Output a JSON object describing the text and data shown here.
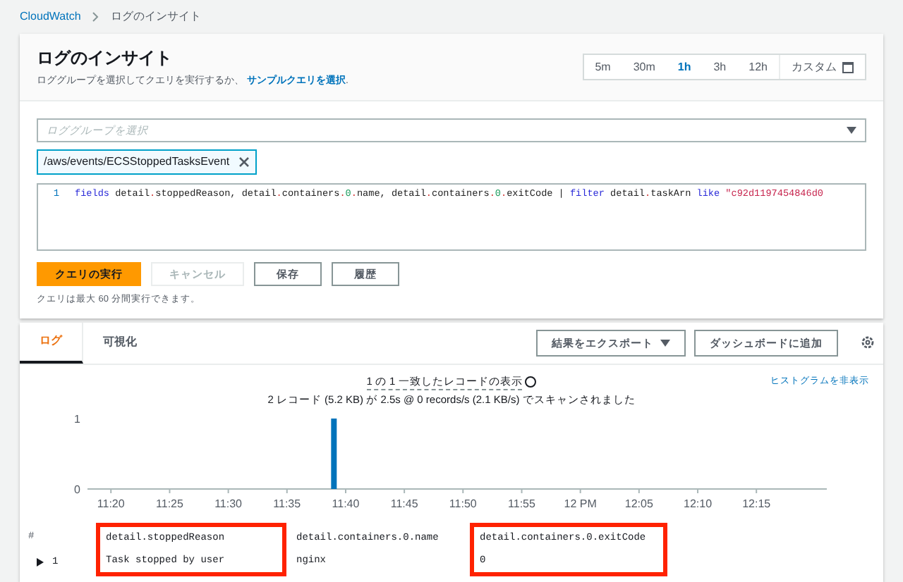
{
  "breadcrumb": {
    "link": "CloudWatch",
    "current": "ログのインサイト"
  },
  "header": {
    "title": "ログのインサイト",
    "description": "ロググループを選択してクエリを実行するか、",
    "description_link": "サンプルクエリを選択",
    "description_end": ".",
    "time_ranges": [
      {
        "label": "5m",
        "selected": false
      },
      {
        "label": "30m",
        "selected": false
      },
      {
        "label": "1h",
        "selected": true
      },
      {
        "label": "3h",
        "selected": false
      },
      {
        "label": "12h",
        "selected": false
      },
      {
        "label": "カスタム",
        "selected": false
      }
    ]
  },
  "log_group_select": {
    "placeholder": "ロググループを選択"
  },
  "selected_groups": [
    "/aws/events/ECSStoppedTasksEvent"
  ],
  "editor": {
    "line_number": "1",
    "tokens": [
      {
        "text": "fields",
        "kind": "keyword"
      },
      {
        "text": " detail",
        "kind": "plain"
      },
      {
        "text": ".",
        "kind": "dot"
      },
      {
        "text": "stoppedReason, detail",
        "kind": "plain"
      },
      {
        "text": ".",
        "kind": "dot"
      },
      {
        "text": "containers",
        "kind": "plain"
      },
      {
        "text": ".",
        "kind": "dot"
      },
      {
        "text": "0",
        "kind": "number"
      },
      {
        "text": ".",
        "kind": "dot"
      },
      {
        "text": "name, detail",
        "kind": "plain"
      },
      {
        "text": ".",
        "kind": "dot"
      },
      {
        "text": "containers",
        "kind": "plain"
      },
      {
        "text": ".",
        "kind": "dot"
      },
      {
        "text": "0",
        "kind": "number"
      },
      {
        "text": ".",
        "kind": "dot"
      },
      {
        "text": "exitCode | ",
        "kind": "plain"
      },
      {
        "text": "filter",
        "kind": "keyword"
      },
      {
        "text": " detail",
        "kind": "plain"
      },
      {
        "text": ".",
        "kind": "dot"
      },
      {
        "text": "taskArn ",
        "kind": "plain"
      },
      {
        "text": "like",
        "kind": "keyword"
      },
      {
        "text": " \"c92d1197454846d0",
        "kind": "string"
      }
    ]
  },
  "actions": [
    {
      "label": "クエリの実行",
      "kind": "primary",
      "disabled": false
    },
    {
      "label": "キャンセル",
      "kind": "normal",
      "disabled": true
    },
    {
      "label": "保存",
      "kind": "normal",
      "disabled": false
    },
    {
      "label": "履歴",
      "kind": "normal",
      "disabled": false
    }
  ],
  "query_note": "クエリは最大 60 分間実行できます。",
  "results": {
    "tabs": [
      {
        "label": "ログ",
        "selected": true
      },
      {
        "label": "可視化",
        "selected": false
      }
    ],
    "export_button": "結果をエクスポート",
    "dashboard_button": "ダッシュボードに追加",
    "summary": "1 の 1 一致したレコードの表示",
    "scan_info": "2 レコード (5.2 KB) が 2.5s @ 0 records/s (2.1 KB/s) でスキャンされました",
    "hide_histogram": "ヒストグラムを非表示",
    "chart_data": {
      "type": "bar",
      "x": [
        11.65
      ],
      "values": [
        1
      ],
      "xlim": [
        11.3,
        12.35
      ],
      "ylim": [
        0,
        1
      ],
      "yticks": [
        0,
        1
      ],
      "xticks": [
        {
          "value": 11.3333,
          "label": "11:20"
        },
        {
          "value": 11.4167,
          "label": "11:25"
        },
        {
          "value": 11.5,
          "label": "11:30"
        },
        {
          "value": 11.5833,
          "label": "11:35"
        },
        {
          "value": 11.6667,
          "label": "11:40"
        },
        {
          "value": 11.75,
          "label": "11:45"
        },
        {
          "value": 11.8333,
          "label": "11:50"
        },
        {
          "value": 11.9167,
          "label": "11:55"
        },
        {
          "value": 12,
          "label": "12 PM"
        },
        {
          "value": 12.0833,
          "label": "12:05"
        },
        {
          "value": 12.1667,
          "label": "12:10"
        },
        {
          "value": 12.25,
          "label": "12:15"
        }
      ]
    },
    "table": {
      "index_header": "#",
      "columns": [
        {
          "header": "detail.stoppedReason",
          "highlighted": true
        },
        {
          "header": "detail.containers.0.name",
          "highlighted": false
        },
        {
          "header": "detail.containers.0.exitCode",
          "highlighted": true
        }
      ],
      "rows": [
        {
          "index": "1",
          "expanded": false,
          "cells": [
            "Task stopped by user",
            "nginx",
            "0"
          ]
        }
      ]
    }
  }
}
